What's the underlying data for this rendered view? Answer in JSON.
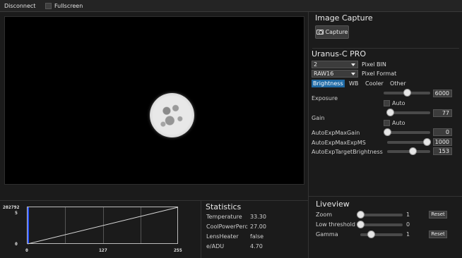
{
  "topbar": {
    "disconnect_label": "Disconnect",
    "fullscreen_label": "Fullscreen"
  },
  "image_capture": {
    "title": "Image Capture",
    "capture_label": "Capture"
  },
  "camera": {
    "title": "Uranus-C PRO",
    "pixel_bin_value": "2",
    "pixel_bin_label": "Pixel BIN",
    "pixel_format_value": "RAW16",
    "pixel_format_label": "Pixel Format",
    "tabs": [
      {
        "label": "Brightness",
        "active": true
      },
      {
        "label": "WB",
        "active": false
      },
      {
        "label": "Cooler",
        "active": false
      },
      {
        "label": "Other",
        "active": false
      }
    ],
    "exposure": {
      "label": "Exposure",
      "value": "6000",
      "level": 0.5,
      "auto_label": "Auto"
    },
    "gain": {
      "label": "Gain",
      "value": "77",
      "level": 0.08,
      "auto_label": "Auto"
    },
    "auto_exp_max_gain": {
      "label": "AutoExpMaxGain",
      "value": "0",
      "level": 0.0
    },
    "auto_exp_max_exp_ms": {
      "label": "AutoExpMaxExpMS",
      "value": "1000",
      "level": 1.0
    },
    "auto_exp_target_brightness": {
      "label": "AutoExpTargetBrightness",
      "value": "153",
      "level": 0.6
    }
  },
  "histogram": {
    "y_max_label": "202792",
    "y_top_tick": "5",
    "y_bottom_tick": "0",
    "x_ticks": [
      "0",
      "127",
      "255"
    ]
  },
  "statistics": {
    "title": "Statistics",
    "rows": [
      {
        "label": "Temperature",
        "value": "33.30"
      },
      {
        "label": "CoolPowerPerc",
        "value": "27.00"
      },
      {
        "label": "LensHeater",
        "value": "false"
      },
      {
        "label": "e/ADU",
        "value": "4.70"
      }
    ]
  },
  "liveview": {
    "title": "Liveview",
    "rows": [
      {
        "label": "Zoom",
        "value": "1",
        "level": 0.0,
        "reset_label": "Reset"
      },
      {
        "label": "Low threshold",
        "value": "0",
        "level": 0.0
      },
      {
        "label": "Gamma",
        "value": "1",
        "level": 0.25,
        "reset_label": "Reset"
      }
    ]
  },
  "colors": {
    "accent": "#1f6aa5",
    "background": "#1b1b1b"
  }
}
